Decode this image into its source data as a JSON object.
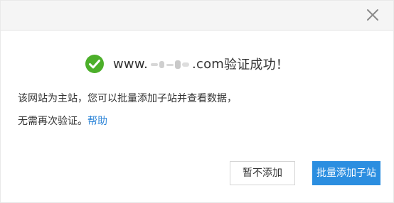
{
  "dialog": {
    "close_icon": "close-icon",
    "success_icon": "check-circle-icon",
    "domain_prefix": "www.",
    "domain_suffix": ".com",
    "success_text": "验证成功！",
    "message_line_1": "该网站为主站，您可以批量添加子站并查看数据，",
    "message_line_2": "无需再次验证。",
    "help_link": "帮助",
    "secondary_button": "暂不添加",
    "primary_button": "批量添加子站",
    "colors": {
      "success": "#4caf2a",
      "link": "#2f86d8",
      "primary": "#2b8ee0"
    }
  }
}
